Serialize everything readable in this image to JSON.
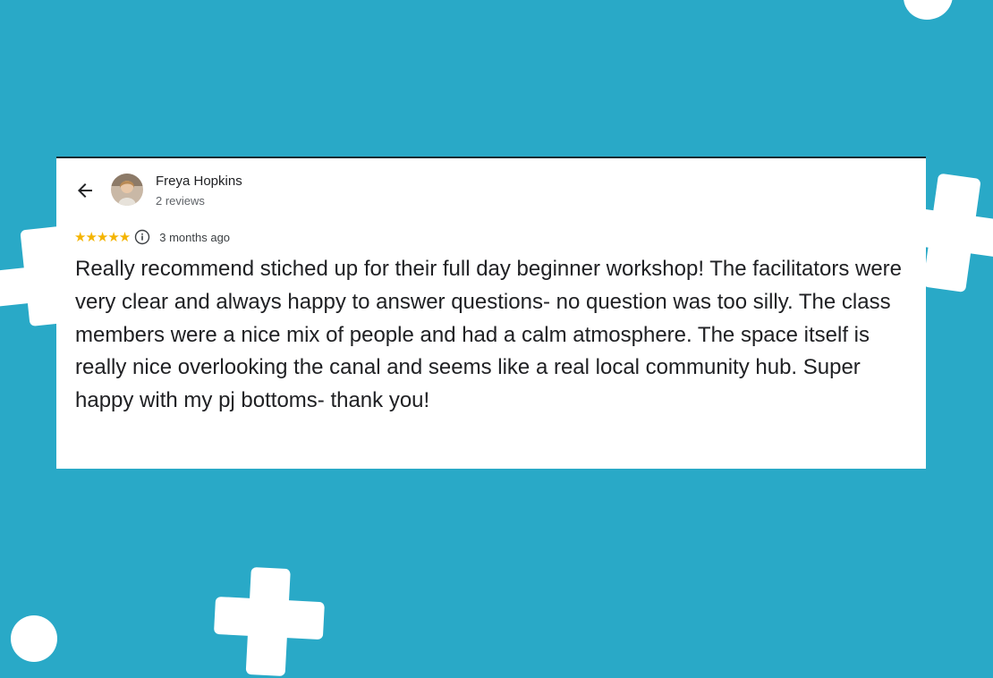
{
  "review": {
    "reviewer_name": "Freya Hopkins",
    "review_count": "2 reviews",
    "rating": 5,
    "stars": "★★★★★",
    "time_ago": "3 months ago",
    "text": "Really recommend stiched up for their full day beginner workshop! The facilitators were very clear and always happy to answer questions- no question was too silly. The class members were a nice mix of people and had a calm atmosphere. The space itself is really nice overlooking the canal and seems like a real local community hub. Super happy with my pj bottoms- thank you!"
  },
  "icons": {
    "back": "arrow-back-icon",
    "info": "info-icon",
    "avatar": "avatar"
  },
  "colors": {
    "background": "#29a9c7",
    "card": "#ffffff",
    "star": "#f4b400",
    "text": "#202124",
    "secondary_text": "#5f6368"
  }
}
